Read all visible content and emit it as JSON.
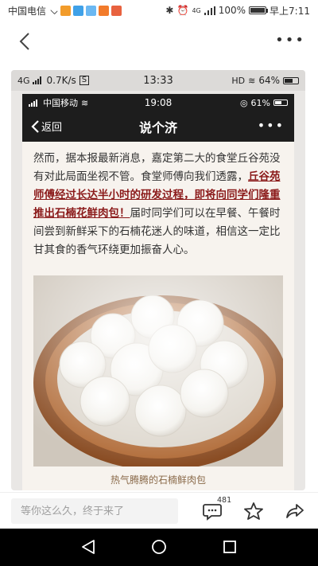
{
  "status_bar": {
    "carrier": "中国电信",
    "network": "4G",
    "battery": "100%",
    "battery_level": 1.0,
    "time": "早上7:11"
  },
  "header": {
    "back_icon": "chevron-left-icon",
    "more_icon": "more-dots-icon"
  },
  "embedded_screenshot": {
    "status": {
      "network": "4G",
      "speed": "0.7K/s",
      "time": "13:33",
      "hd": "HD",
      "battery": "64%",
      "battery_level": 0.64
    },
    "inner": {
      "status": {
        "carrier": "中国移动",
        "time": "19:08",
        "battery": "61%",
        "battery_level": 0.61
      },
      "nav": {
        "back_label": "返回",
        "title": "说个济"
      },
      "article": {
        "text_before": "然而，据本报最新消息，嘉定第二大的食堂丘谷苑没有对此局面坐视不管。食堂师傅向我们透露，",
        "highlight": "丘谷苑师傅经过长达半小时的研发过程，即将向同学们隆重推出石楠花鲜肉包！",
        "text_after": "届时同学们可以在早餐、午餐时间尝到新鲜采下的石楠花迷人的味道，相信这一定比甘其食的香气环绕更加振奋人心。"
      },
      "photo_caption": "热气腾腾的石楠鲜肉包"
    }
  },
  "bottom_bar": {
    "comment_placeholder": "等你这么久，终于来了",
    "comment_count": "481",
    "icons": [
      "comment-icon",
      "star-icon",
      "share-icon"
    ]
  },
  "nav_bar": {
    "icons": [
      "back-triangle-icon",
      "home-circle-icon",
      "recents-square-icon"
    ]
  }
}
